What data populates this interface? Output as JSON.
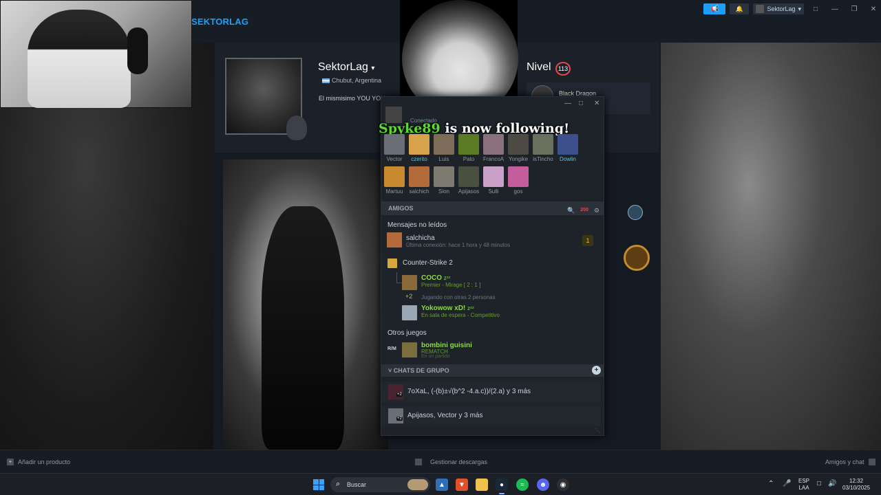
{
  "steam": {
    "brand": "SEKTORLAG",
    "topbar": {
      "user_name": "SektorLag",
      "announce_icon": "megaphone-icon",
      "bell_icon": "bell-icon"
    },
    "accent": "#1a9fff"
  },
  "profile": {
    "name": "SektorLag",
    "location": "Chubut, Argentina",
    "summary": "El mismisimo YOU YOU",
    "level_label": "Nivel",
    "level": "113",
    "badge_name": "Black Dragon"
  },
  "friends_window": {
    "status": "Conectado",
    "notification": {
      "friend": "Spyke89",
      "text": " is now following!"
    },
    "favorites": [
      {
        "name": "Vector",
        "color": "#6a6f77",
        "active": false
      },
      {
        "name": "czerito",
        "color": "#d8a24a",
        "active": true
      },
      {
        "name": "Luis",
        "color": "#7c6c58",
        "active": false
      },
      {
        "name": "Pato",
        "color": "#5b7a23",
        "active": false
      },
      {
        "name": "FrancoA",
        "color": "#8a6f7d",
        "active": false
      },
      {
        "name": "Yongike",
        "color": "#4e4a44",
        "active": false
      },
      {
        "name": "isTincho",
        "color": "#69705e",
        "active": false
      },
      {
        "name": "Dowlin",
        "color": "#3d4f8c",
        "active": true
      },
      {
        "name": "Martuu",
        "color": "#c98a2f",
        "active": false
      },
      {
        "name": "salchich",
        "color": "#b46a3a",
        "active": false
      },
      {
        "name": "Sion",
        "color": "#7d7a70",
        "active": false
      },
      {
        "name": "Apijasos",
        "color": "#4a503f",
        "active": false
      },
      {
        "name": "Sulli",
        "color": "#c9a0c8",
        "active": false
      },
      {
        "name": "gos",
        "color": "#c35d9b",
        "active": false
      }
    ],
    "friends_header": "AMIGOS",
    "friends_header_badge": "200",
    "unread_label": "Mensajes no leídos",
    "unread_friend": {
      "name": "salchicha",
      "sub": "Última conexión: hace 1 hora y 48 minutos",
      "count": "1"
    },
    "cs2": {
      "title": "Counter-Strike 2",
      "friends": [
        {
          "name": "COCO",
          "sub": "Premier - Mirage [ 2 : 1 ]",
          "zz": "zᶻᶻ"
        },
        {
          "name": "Yokowow xD! ",
          "sub": "En sala de espera - Competitivo",
          "zz": "zᶻᶻ"
        }
      ],
      "more_count": "+2",
      "more_text": "Jugando con otras 2 personas"
    },
    "other_games": {
      "title": "Otros juegos",
      "friend_name": "bombini guisini",
      "game": "REMATCH",
      "sub": "En un partido"
    },
    "group_chats_header": "CHATS DE GRUPO",
    "group_chats": [
      {
        "text": "7oXaL, (-(b)±√(b^2 -4.a.c))/(2.a) y 3 más",
        "count": "+2"
      },
      {
        "text": "Apijasos, Vector y 3 más",
        "count": "+2"
      }
    ]
  },
  "bottom_bar": {
    "add_product": "Añadir un producto",
    "downloads": "Gestionar descargas",
    "friends_chat": "Amigos y chat"
  },
  "taskbar": {
    "search": "Buscar",
    "lang": "ESP",
    "lang_sub": "LAA",
    "time": "12:32",
    "date": "03/10/2025"
  }
}
